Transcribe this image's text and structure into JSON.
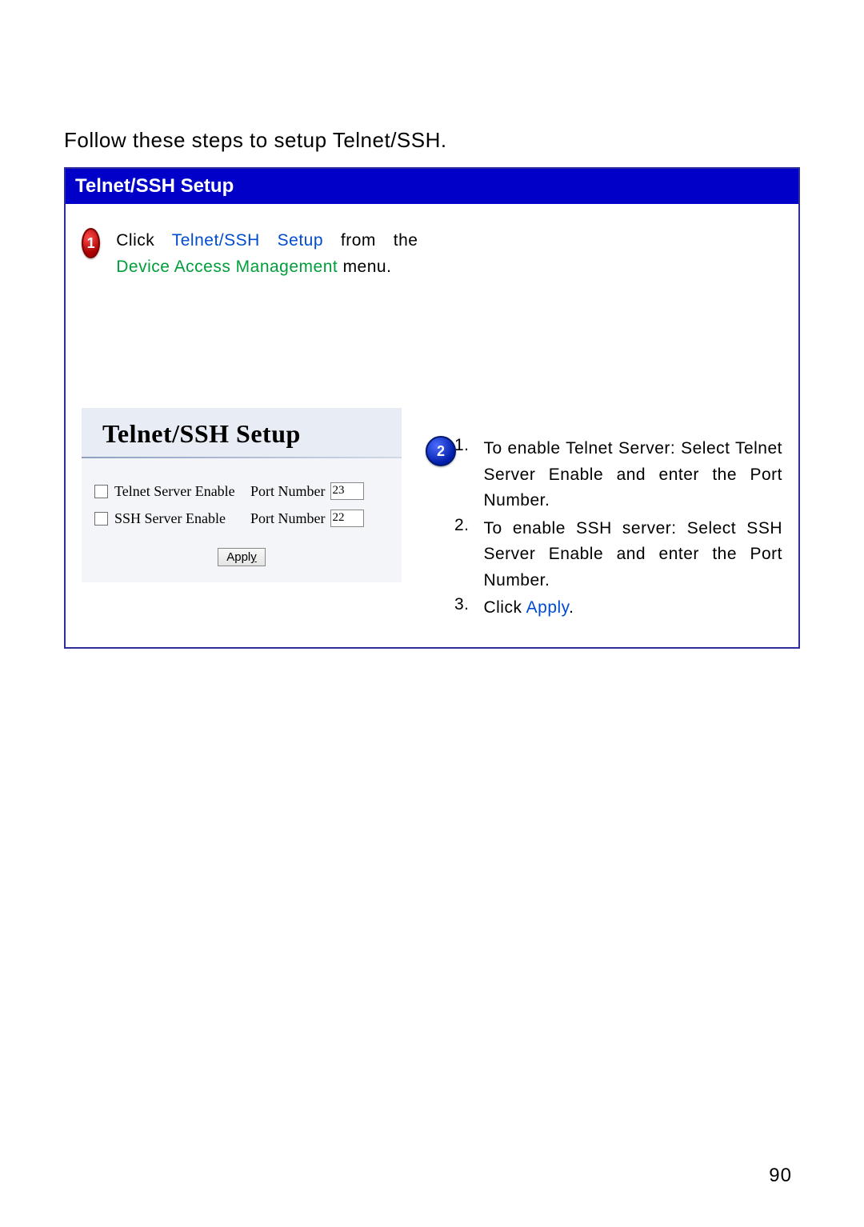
{
  "intro": "Follow these steps to setup Telnet/SSH.",
  "title_bar": "Telnet/SSH Setup",
  "step1": {
    "num": "1",
    "click_word": "Click ",
    "link": "Telnet/SSH Setup",
    "mid": " from the ",
    "menu": "Device Access Management",
    "tail": " menu."
  },
  "screenshot": {
    "heading": "Telnet/SSH Setup",
    "row1": {
      "label": "Telnet Server Enable",
      "port_label": "Port Number",
      "port_value": "23"
    },
    "row2": {
      "label": "SSH Server Enable",
      "port_label": "Port Number",
      "port_value": "22"
    },
    "apply_full": "Apply",
    "apply_rest": "Appl",
    "apply_u": "y"
  },
  "step2": {
    "num": "2"
  },
  "instructions": [
    {
      "n": "1.",
      "text": "To enable Telnet Server: Select Telnet Server Enable and enter the Port Number."
    },
    {
      "n": "2.",
      "text": "To enable SSH server: Select SSH Server Enable and enter the Port Number."
    }
  ],
  "instruction3": {
    "n": "3.",
    "prefix": "Click ",
    "link": "Apply",
    "suffix": "."
  },
  "page_number": "90"
}
